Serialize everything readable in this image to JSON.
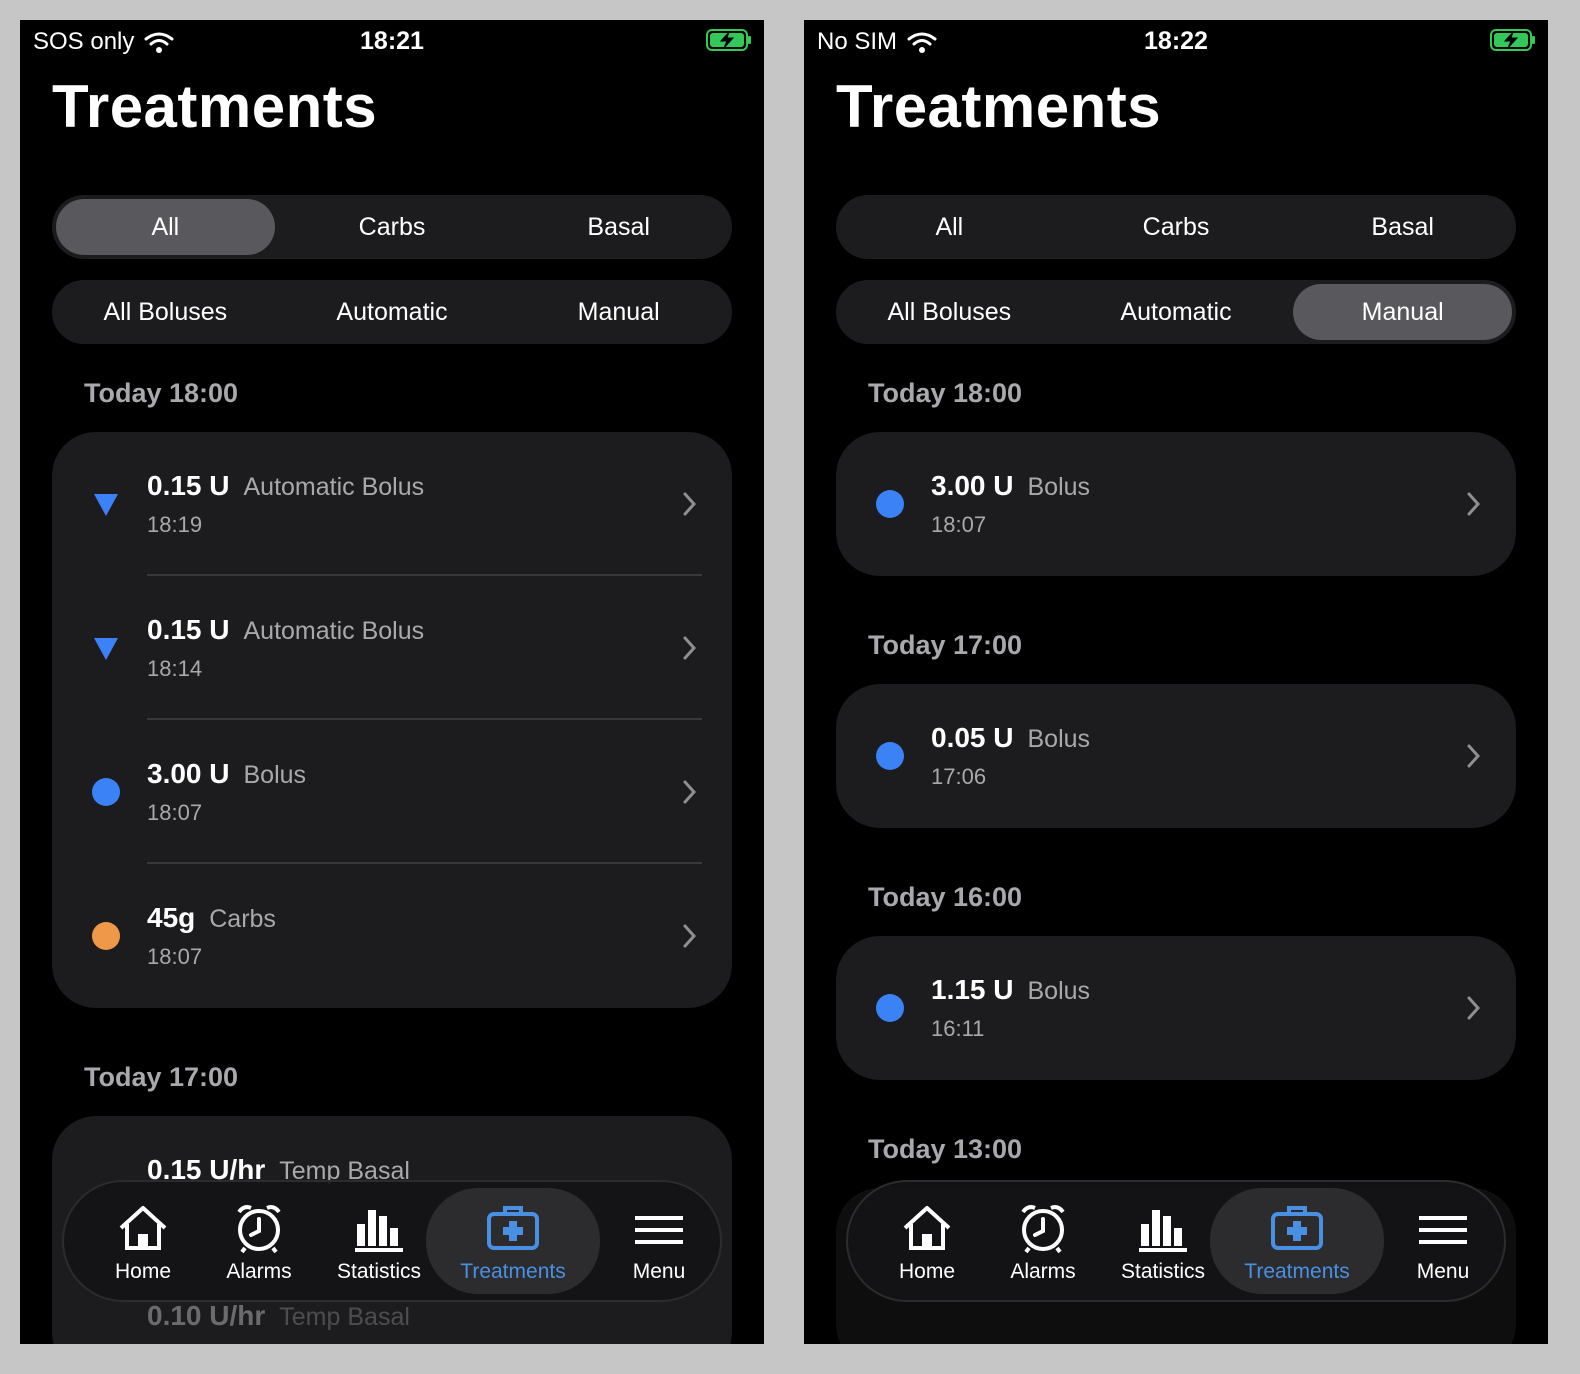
{
  "left": {
    "status": {
      "carrier": "SOS only",
      "time": "18:21"
    },
    "title": "Treatments",
    "filters1": [
      "All",
      "Carbs",
      "Basal"
    ],
    "filters2": [
      "All Boluses",
      "Automatic",
      "Manual"
    ],
    "active_filter1": "All",
    "sections": [
      {
        "header": "Today 18:00",
        "items": [
          {
            "amount": "0.15 U",
            "kind": "Automatic Bolus",
            "time": "18:19",
            "marker": "triangle-blue"
          },
          {
            "amount": "0.15 U",
            "kind": "Automatic Bolus",
            "time": "18:14",
            "marker": "triangle-blue"
          },
          {
            "amount": "3.00 U",
            "kind": "Bolus",
            "time": "18:07",
            "marker": "dot-blue"
          },
          {
            "amount": "45g",
            "kind": "Carbs",
            "time": "18:07",
            "marker": "dot-orange"
          }
        ]
      },
      {
        "header": "Today 17:00",
        "items": [
          {
            "amount": "0.15 U/hr",
            "kind": "Temp Basal"
          },
          {
            "amount": "0.10 U/hr",
            "kind": "Temp Basal"
          }
        ]
      }
    ]
  },
  "right": {
    "status": {
      "carrier": "No SIM",
      "time": "18:22"
    },
    "title": "Treatments",
    "filters1": [
      "All",
      "Carbs",
      "Basal"
    ],
    "filters2": [
      "All Boluses",
      "Automatic",
      "Manual"
    ],
    "active_filter2": "Manual",
    "sections": [
      {
        "header": "Today 18:00",
        "items": [
          {
            "amount": "3.00 U",
            "kind": "Bolus",
            "time": "18:07",
            "marker": "dot-blue"
          }
        ]
      },
      {
        "header": "Today 17:00",
        "items": [
          {
            "amount": "0.05 U",
            "kind": "Bolus",
            "time": "17:06",
            "marker": "dot-blue"
          }
        ]
      },
      {
        "header": "Today 16:00",
        "items": [
          {
            "amount": "1.15 U",
            "kind": "Bolus",
            "time": "16:11",
            "marker": "dot-blue"
          }
        ]
      },
      {
        "header": "Today 13:00",
        "items": []
      }
    ]
  },
  "tabbar": {
    "tabs": [
      {
        "label": "Home",
        "icon": "house-icon"
      },
      {
        "label": "Alarms",
        "icon": "alarm-clock-icon"
      },
      {
        "label": "Statistics",
        "icon": "bar-chart-icon"
      },
      {
        "label": "Treatments",
        "icon": "medical-kit-icon"
      },
      {
        "label": "Menu",
        "icon": "hamburger-menu-icon"
      }
    ],
    "active": "Treatments"
  },
  "colors": {
    "accent": "#4a90e2",
    "bolus": "#3b82f6",
    "carbs": "#f0984a",
    "battery": "#34c759"
  }
}
